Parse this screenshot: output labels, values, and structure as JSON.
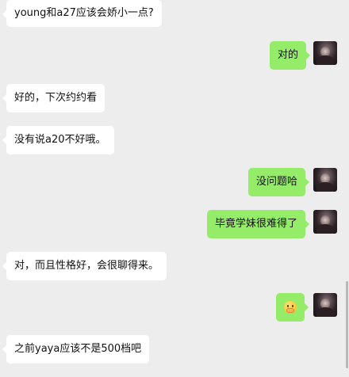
{
  "window": {
    "title": ""
  },
  "colors": {
    "background": "#ededed",
    "incoming_bubble": "#ffffff",
    "outgoing_bubble": "#95ec69"
  },
  "messages": [
    {
      "side": "in",
      "text": "young和a27应该会娇小一点?"
    },
    {
      "side": "out",
      "text": "对的"
    },
    {
      "side": "in",
      "text": "好的，下次约约看"
    },
    {
      "side": "in",
      "text": "没有说a20不好哦。"
    },
    {
      "side": "out",
      "text": "没问题哈"
    },
    {
      "side": "out",
      "text": "毕竟学妹很难得了"
    },
    {
      "side": "in",
      "text": "对，而且性格好，会很聊得来。"
    },
    {
      "side": "out",
      "icon": "hand-over-mouth-emoji-icon"
    },
    {
      "side": "in",
      "text": "之前yaya应该不是500档吧"
    }
  ]
}
